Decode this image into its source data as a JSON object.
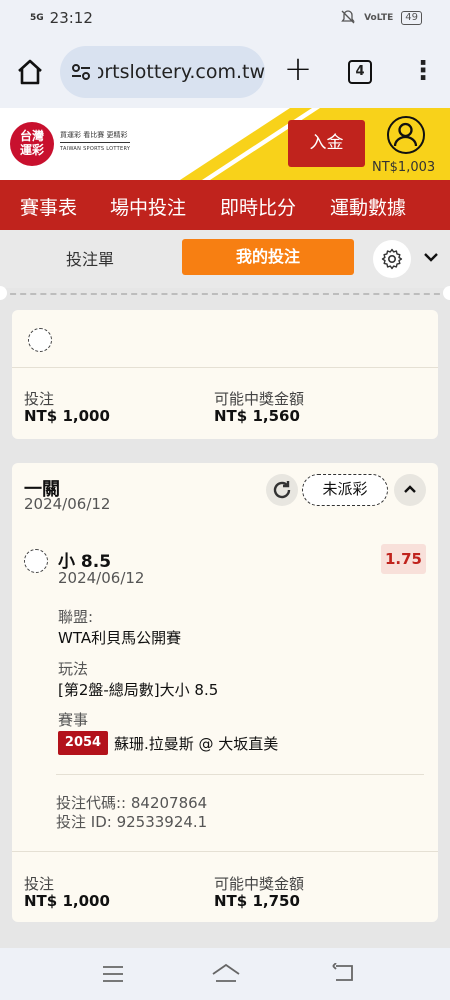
{
  "status_bar": {
    "time": "23:12",
    "signal": "5G",
    "battery": "49"
  },
  "browser": {
    "url": "sportslottery.com.tw",
    "tab_count": "4"
  },
  "site": {
    "logo_mark": "台灣運彩",
    "logo_text": "買運彩 看比賽 更精彩",
    "logo_subtext": "TAIWAN SPORTS LOTTERY",
    "deposit_label": "入金",
    "balance": "NT$1,003"
  },
  "nav": [
    "賽事表",
    "場中投注",
    "即時比分",
    "運動數據"
  ],
  "sub_tabs": {
    "bet_slip": "投注單",
    "my_bets": "我的投注"
  },
  "card1": {
    "stake_label": "投注",
    "stake_value": "NT$ 1,000",
    "payout_label": "可能中獎金額",
    "payout_value": "NT$ 1,560"
  },
  "card2": {
    "title": "一關",
    "date": "2024/06/12",
    "status": "未派彩",
    "selection": {
      "title": "小 8.5",
      "date": "2024/06/12",
      "odds": "1.75",
      "league_label": "聯盟:",
      "league_value": "WTA利貝馬公開賽",
      "market_label": "玩法",
      "market_value": "[第2盤-總局數]大小 8.5",
      "event_label": "賽事",
      "event_code": "2054",
      "event_name": "蘇珊.拉曼斯 @ 大坂直美"
    },
    "bet_code": "投注代碼:: 84207864",
    "bet_id": "投注 ID: 92533924.1",
    "stake_label": "投注",
    "stake_value": "NT$ 1,000",
    "payout_label": "可能中獎金額",
    "payout_value": "NT$ 1,750"
  },
  "colors": {
    "brand_red": "#c0231d",
    "accent_orange": "#f77f12",
    "yellow": "#f8d21a"
  }
}
